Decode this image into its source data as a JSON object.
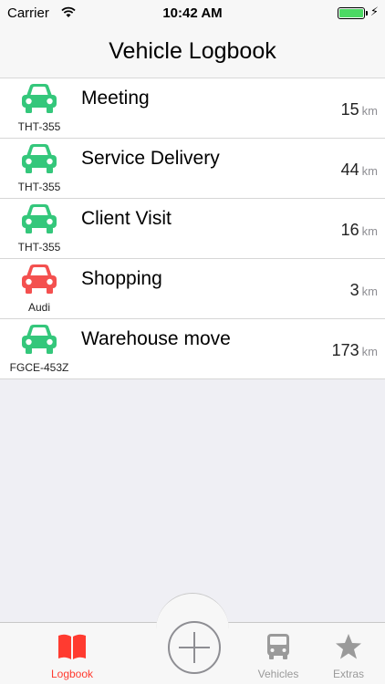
{
  "status_bar": {
    "carrier": "Carrier",
    "time": "10:42 AM"
  },
  "nav": {
    "title": "Vehicle Logbook"
  },
  "entries": [
    {
      "title": "Meeting",
      "vehicle": "THT-355",
      "distance": "15",
      "unit": "km",
      "icon": "car-icon",
      "color": "#34c77b"
    },
    {
      "title": "Service Delivery",
      "vehicle": "THT-355",
      "distance": "44",
      "unit": "km",
      "icon": "car-icon",
      "color": "#34c77b"
    },
    {
      "title": "Client Visit",
      "vehicle": "THT-355",
      "distance": "16",
      "unit": "km",
      "icon": "car-icon",
      "color": "#34c77b"
    },
    {
      "title": "Shopping",
      "vehicle": "Audi",
      "distance": "3",
      "unit": "km",
      "icon": "car-icon",
      "color": "#f4504f"
    },
    {
      "title": "Warehouse move",
      "vehicle": "FGCE-453Z",
      "distance": "173",
      "unit": "km",
      "icon": "car-icon",
      "color": "#34c77b"
    }
  ],
  "tab_bar": {
    "logbook": "Logbook",
    "vehicles": "Vehicles",
    "extras": "Extras",
    "active_color": "#ff3b30",
    "inactive_color": "#9a9a9a"
  }
}
